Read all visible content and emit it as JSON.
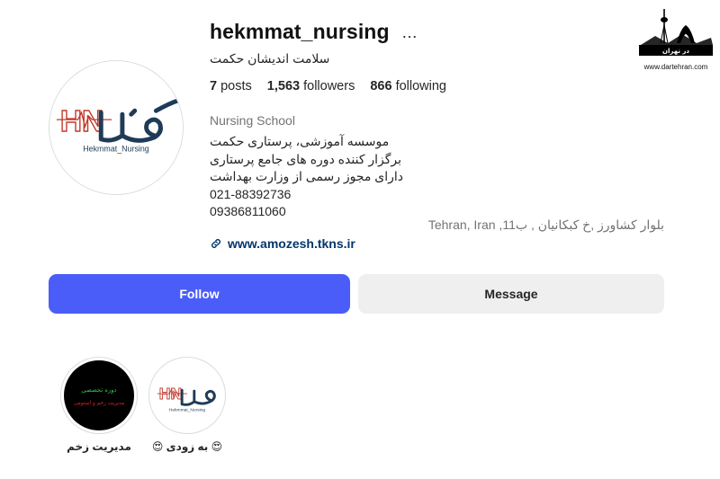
{
  "profile": {
    "username": "hekmmat_nursing",
    "more_icon": "…",
    "full_name": "سلامت اندیشان حکمت",
    "avatar_text": "Hekmmat_Nursing",
    "stats": {
      "posts_count": "7",
      "posts_label": "posts",
      "followers_count": "1,563",
      "followers_label": "followers",
      "following_count": "866",
      "following_label": "following"
    },
    "category": "Nursing School",
    "bio_lines": [
      "موسسه آموزشی، پرستاری حکمت",
      "برگزار کننده دوره های جامع پرستاری",
      "دارای مجوز رسمی از وزارت بهداشت",
      "021-88392736",
      "09386811060"
    ],
    "address": "بلوار کشاورز ,خ کبکانیان , ب11, Tehran, Iran",
    "link": "www.amozesh.tkns.ir",
    "link_icon": "link-icon"
  },
  "buttons": {
    "follow": "Follow",
    "message": "Message"
  },
  "highlights": [
    {
      "label": "مدیریت زخم",
      "cover_lines": [
        "دوره تخصصی",
        "مدیریت زخم و استومی"
      ]
    },
    {
      "label": "😍 به زودی 😍",
      "cover_text": "Hekmmat_Nursing"
    }
  ],
  "watermark": {
    "brand": "در تهران",
    "url": "www.dartehran.com"
  },
  "colors": {
    "follow_bg": "#4a5df9",
    "message_bg": "#efefef",
    "link": "#00376b",
    "secondary_text": "#737373",
    "logo_red": "#c0392b",
    "logo_navy": "#1f3b57",
    "highlight_green": "#2ecc40",
    "highlight_red": "#e0242f"
  }
}
